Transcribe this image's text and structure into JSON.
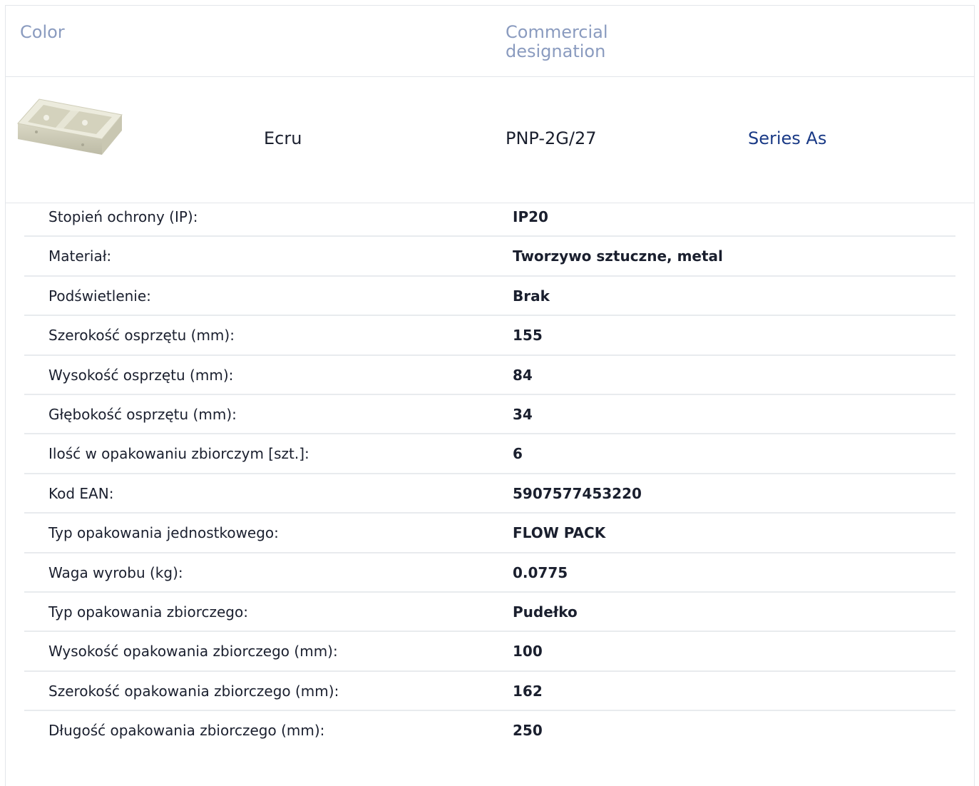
{
  "header": {
    "color_label": "Color",
    "commercial_label": "Commercial designation"
  },
  "product": {
    "image_icon": "surface-box-double-icon",
    "color": "Ecru",
    "code": "PNP-2G/27",
    "series_link": "Series As"
  },
  "specs": [
    {
      "label": "Stopień ochrony (IP):",
      "value": "IP20"
    },
    {
      "label": "Materiał:",
      "value": "Tworzywo sztuczne, metal"
    },
    {
      "label": "Podświetlenie:",
      "value": "Brak"
    },
    {
      "label": "Szerokość osprzętu (mm):",
      "value": "155"
    },
    {
      "label": "Wysokość osprzętu (mm):",
      "value": "84"
    },
    {
      "label": "Głębokość osprzętu (mm):",
      "value": "34"
    },
    {
      "label": "Ilość w opakowaniu zbiorczym [szt.]:",
      "value": "6"
    },
    {
      "label": "Kod EAN:",
      "value": "5907577453220"
    },
    {
      "label": "Typ opakowania jednostkowego:",
      "value": "FLOW PACK"
    },
    {
      "label": "Waga wyrobu (kg):",
      "value": "0.0775"
    },
    {
      "label": "Typ opakowania zbiorczego:",
      "value": "Pudełko"
    },
    {
      "label": "Wysokość opakowania zbiorczego (mm):",
      "value": "100"
    },
    {
      "label": "Szerokość opakowania zbiorczego (mm):",
      "value": "162"
    },
    {
      "label": "Długość opakowania zbiorczego (mm):",
      "value": "250"
    }
  ],
  "colors": {
    "header_text": "#8a9bbf",
    "link": "#1a3a86",
    "border": "#e3e6ea"
  }
}
